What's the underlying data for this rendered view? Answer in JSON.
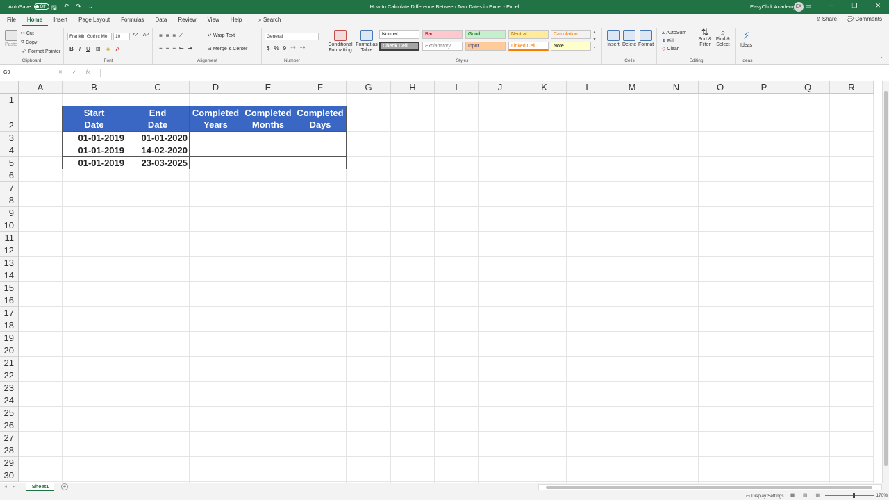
{
  "titlebar": {
    "autosave_label": "AutoSave",
    "autosave_state": "Off",
    "doc_title": "How to Calculate Difference Between Two Dates in Excel  -  Excel",
    "user_name": "EasyClick Academy",
    "user_initials": "EA"
  },
  "tabs": [
    "File",
    "Home",
    "Insert",
    "Page Layout",
    "Formulas",
    "Data",
    "Review",
    "View",
    "Help"
  ],
  "search_label": "Search",
  "share_label": "Share",
  "comments_label": "Comments",
  "ribbon": {
    "clipboard": {
      "paste": "Paste",
      "cut": "Cut",
      "copy": "Copy",
      "format_painter": "Format Painter",
      "label": "Clipboard"
    },
    "font": {
      "font_name": "Franklin Gothic Me",
      "font_size": "10",
      "bold": "B",
      "italic": "I",
      "underline": "U",
      "label": "Font"
    },
    "alignment": {
      "wrap_text": "Wrap Text",
      "merge_center": "Merge & Center",
      "label": "Alignment"
    },
    "number": {
      "format": "General",
      "currency": "$",
      "percent": "%",
      "comma": "9",
      "label": "Number"
    },
    "styles": {
      "conditional_formatting": "Conditional Formatting",
      "format_as_table": "Format as Table",
      "cell_styles": [
        {
          "name": "Normal",
          "bg": "#ffffff",
          "fg": "#000000"
        },
        {
          "name": "Bad",
          "bg": "#ffc7ce",
          "fg": "#9c0006"
        },
        {
          "name": "Good",
          "bg": "#c6efce",
          "fg": "#006100"
        },
        {
          "name": "Neutral",
          "bg": "#ffeb9c",
          "fg": "#9c5700"
        },
        {
          "name": "Calculation",
          "bg": "#f2f2f2",
          "fg": "#fa7d00"
        },
        {
          "name": "Check Cell",
          "bg": "#a5a5a5",
          "fg": "#ffffff"
        },
        {
          "name": "Explanatory ...",
          "bg": "#ffffff",
          "fg": "#7f7f7f"
        },
        {
          "name": "Input",
          "bg": "#ffcc99",
          "fg": "#3f3f76"
        },
        {
          "name": "Linked Cell",
          "bg": "#ffffff",
          "fg": "#fa7d00"
        },
        {
          "name": "Note",
          "bg": "#ffffcc",
          "fg": "#000000"
        }
      ],
      "label": "Styles"
    },
    "cells": {
      "insert": "Insert",
      "delete": "Delete",
      "format": "Format",
      "label": "Cells"
    },
    "editing": {
      "autosum": "AutoSum",
      "fill": "Fill",
      "clear": "Clear",
      "sort_filter": "Sort & Filter",
      "find_select": "Find & Select",
      "label": "Editing"
    },
    "ideas": {
      "ideas": "Ideas",
      "label": "Ideas"
    }
  },
  "formula_bar": {
    "name_box": "G9",
    "cancel": "✕",
    "enter": "✓",
    "fx": "fx",
    "content": ""
  },
  "columns": [
    "A",
    "B",
    "C",
    "D",
    "E",
    "F",
    "G",
    "H",
    "I",
    "J",
    "K",
    "L",
    "M",
    "N",
    "O",
    "P",
    "Q",
    "R"
  ],
  "rows": [
    "1",
    "2",
    "3",
    "4",
    "5",
    "6",
    "7",
    "8",
    "9",
    "10",
    "11",
    "12",
    "13",
    "14",
    "15",
    "16",
    "17",
    "18",
    "19",
    "20",
    "21",
    "22",
    "23",
    "24",
    "25",
    "26",
    "27",
    "28",
    "29",
    "30"
  ],
  "table": {
    "header_bg": "#3a66c4",
    "headers": [
      [
        "Start",
        "Date"
      ],
      [
        "End",
        "Date"
      ],
      [
        "Completed",
        "Years"
      ],
      [
        "Completed",
        "Months"
      ],
      [
        "Completed",
        "Days"
      ]
    ],
    "rows": [
      [
        "01-01-2019",
        "01-01-2020",
        "",
        "",
        ""
      ],
      [
        "01-01-2019",
        "14-02-2020",
        "",
        "",
        ""
      ],
      [
        "01-01-2019",
        "23-03-2025",
        "",
        "",
        ""
      ]
    ]
  },
  "sheets": [
    "Sheet1"
  ],
  "status": {
    "display_settings": "Display Settings",
    "zoom": "170%"
  }
}
